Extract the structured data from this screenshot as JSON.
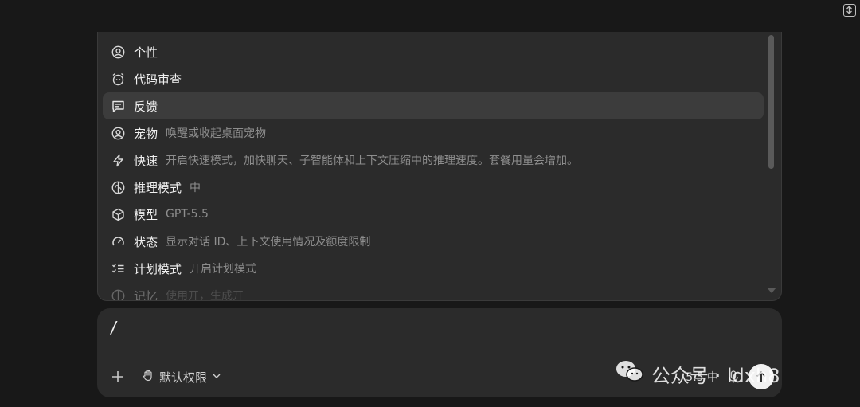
{
  "menu": {
    "items": [
      {
        "label": "个性",
        "desc": "",
        "icon": "user-circle-icon"
      },
      {
        "label": "代码审查",
        "desc": "",
        "icon": "alarm-clock-icon"
      },
      {
        "label": "反馈",
        "desc": "",
        "icon": "message-square-icon",
        "selected": true
      },
      {
        "label": "宠物",
        "desc": "唤醒或收起桌面宠物",
        "icon": "pet-face-icon"
      },
      {
        "label": "快速",
        "desc": "开启快速模式，加快聊天、子智能体和上下文压缩中的推理速度。套餐用量会增加。",
        "icon": "lightning-icon"
      },
      {
        "label": "推理模式",
        "desc": "中",
        "icon": "brain-icon"
      },
      {
        "label": "模型",
        "desc": "GPT-5.5",
        "icon": "cube-icon"
      },
      {
        "label": "状态",
        "desc": "显示对话 ID、上下文使用情况及额度限制",
        "icon": "gauge-icon"
      },
      {
        "label": "计划模式",
        "desc": "开启计划模式",
        "icon": "checklist-icon"
      },
      {
        "label": "记忆",
        "desc": "使用开，生成开",
        "icon": "memory-icon"
      }
    ]
  },
  "composer": {
    "input_text": "/",
    "permission_label": "默认权限",
    "model_label": "5.5 中"
  },
  "watermark": {
    "text": "公众号 · ldxh8"
  }
}
